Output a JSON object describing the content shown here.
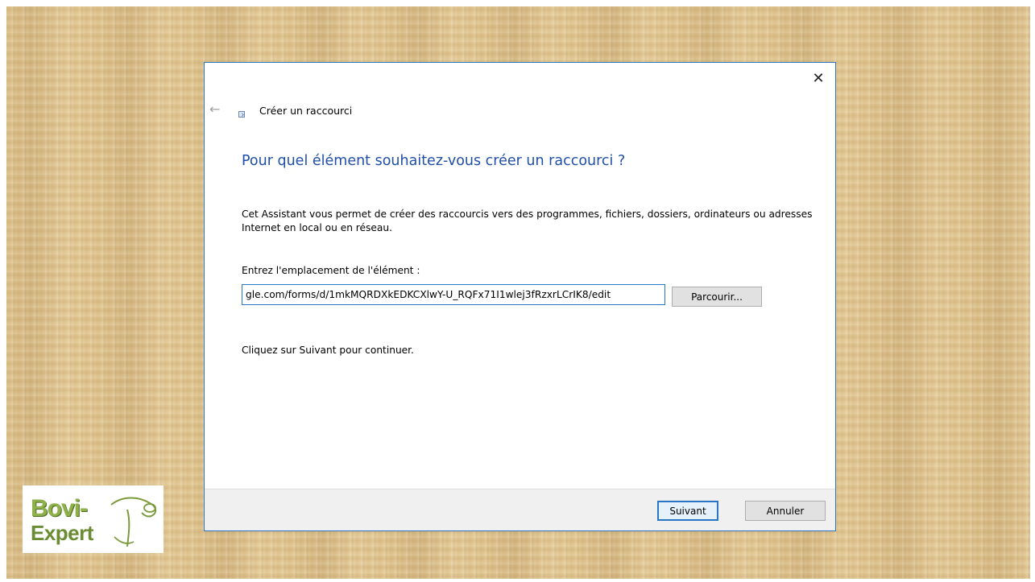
{
  "dialog": {
    "close_glyph": "✕",
    "back_glyph": "←",
    "wizard_title": "Créer un raccourci",
    "heading": "Pour quel élément souhaitez-vous créer un raccourci ?",
    "description": "Cet Assistant vous permet de créer des raccourcis vers des programmes, fichiers, dossiers, ordinateurs ou adresses Internet en local ou en réseau.",
    "location_label": "Entrez l'emplacement de l'élément :",
    "location_value": "gle.com/forms/d/1mkMQRDXkEDKCXlwY-U_RQFx71I1wlej3fRzxrLCrIK8/edit",
    "browse_label": "Parcourir...",
    "hint": "Cliquez sur Suivant pour continuer.",
    "next_label": "Suivant",
    "cancel_label": "Annuler"
  },
  "logo": {
    "line1": "Bovi-",
    "line2": "Expert"
  },
  "colors": {
    "accent": "#2a76c6",
    "heading": "#1f4fa8",
    "background": "#e2c791",
    "logo_green": "#8fb14a"
  }
}
